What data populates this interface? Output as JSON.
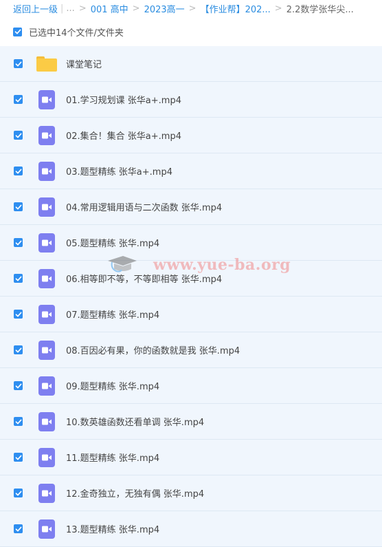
{
  "breadcrumb": {
    "back": "返回上一级",
    "ellipsis": "...",
    "items": [
      "001 高中",
      "2023高一",
      "【作业帮】202...",
      "2.2数学张华尖..."
    ]
  },
  "selection": {
    "label": "已选中14个文件/文件夹"
  },
  "files": [
    {
      "type": "folder",
      "name": "课堂笔记"
    },
    {
      "type": "video",
      "name": "01.学习规划课 张华a+.mp4"
    },
    {
      "type": "video",
      "name": "02.集合！集合 张华a+.mp4"
    },
    {
      "type": "video",
      "name": "03.题型精练 张华a+.mp4"
    },
    {
      "type": "video",
      "name": "04.常用逻辑用语与二次函数 张华.mp4"
    },
    {
      "type": "video",
      "name": "05.题型精练 张华.mp4"
    },
    {
      "type": "video",
      "name": "06.相等即不等，不等即相等 张华.mp4"
    },
    {
      "type": "video",
      "name": "07.题型精练 张华.mp4"
    },
    {
      "type": "video",
      "name": "08.百因必有果，你的函数就是我 张华.mp4"
    },
    {
      "type": "video",
      "name": "09.题型精练 张华.mp4"
    },
    {
      "type": "video",
      "name": "10.数英雄函数还看单调 张华.mp4"
    },
    {
      "type": "video",
      "name": "11.题型精练 张华.mp4"
    },
    {
      "type": "video",
      "name": "12.金奇独立，无独有偶 张华.mp4"
    },
    {
      "type": "video",
      "name": "13.题型精练 张华.mp4"
    }
  ],
  "watermark": {
    "text": "www.yue-ba.org"
  },
  "colors": {
    "accent": "#2e8ef0",
    "row_bg": "#f0f6fd",
    "video_icon": "#7e7ff0",
    "folder": "#fbcb45"
  }
}
